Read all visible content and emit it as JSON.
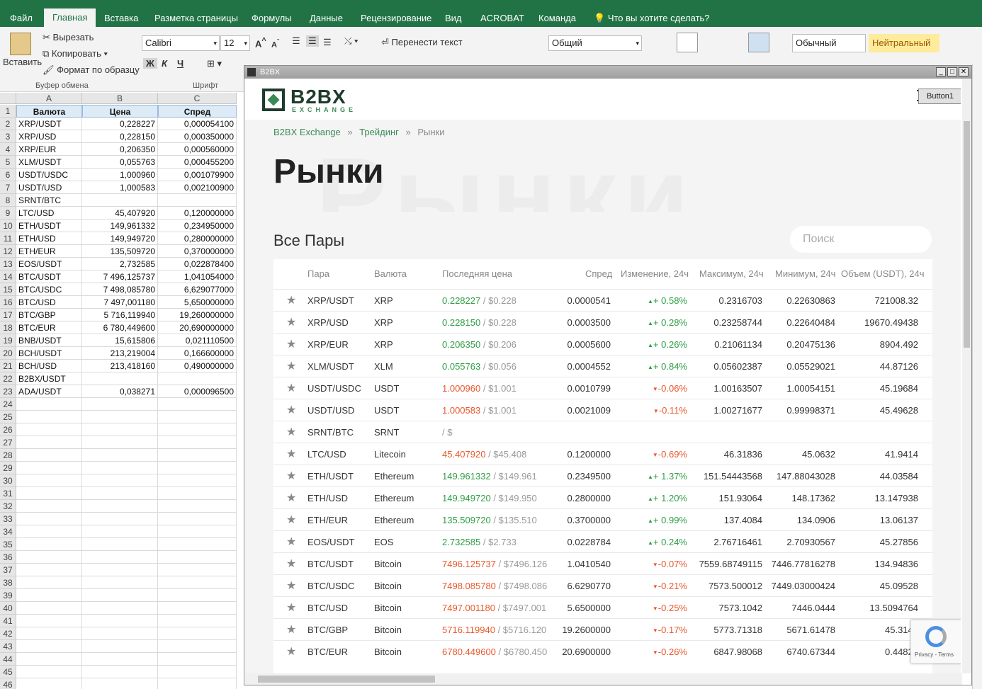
{
  "excel": {
    "tabs": [
      "Файл",
      "Главная",
      "Вставка",
      "Разметка страницы",
      "Формулы",
      "Данные",
      "Рецензирование",
      "Вид",
      "ACROBAT",
      "Команда"
    ],
    "tellme": "Что вы хотите сделать?",
    "clipboard": {
      "paste": "Вставить",
      "cut": "Вырезать",
      "copy": "Копировать",
      "format_painter": "Формат по образцу",
      "group": "Буфер обмена"
    },
    "font": {
      "name": "Calibri",
      "size": "12",
      "group": "Шрифт",
      "bold": "Ж",
      "italic": "К",
      "underline": "Ч"
    },
    "wrap_text": "Перенести текст",
    "number_format": "Общий",
    "style_normal": "Обычный",
    "style_neutral": "Нейтральный",
    "columns": [
      "A",
      "B",
      "C"
    ],
    "header_row": [
      "Валюта",
      "Цена",
      "Спред"
    ],
    "rows": [
      [
        "XRP/USDT",
        "0,228227",
        "0,000054100"
      ],
      [
        "XRP/USD",
        "0,228150",
        "0,000350000"
      ],
      [
        "XRP/EUR",
        "0,206350",
        "0,000560000"
      ],
      [
        "XLM/USDT",
        "0,055763",
        "0,000455200"
      ],
      [
        "USDT/USDC",
        "1,000960",
        "0,001079900"
      ],
      [
        "USDT/USD",
        "1,000583",
        "0,002100900"
      ],
      [
        "SRNT/BTC",
        "",
        ""
      ],
      [
        "LTC/USD",
        "45,407920",
        "0,120000000"
      ],
      [
        "ETH/USDT",
        "149,961332",
        "0,234950000"
      ],
      [
        "ETH/USD",
        "149,949720",
        "0,280000000"
      ],
      [
        "ETH/EUR",
        "135,509720",
        "0,370000000"
      ],
      [
        "EOS/USDT",
        "2,732585",
        "0,022878400"
      ],
      [
        "BTC/USDT",
        "7 496,125737",
        "1,041054000"
      ],
      [
        "BTC/USDC",
        "7 498,085780",
        "6,629077000"
      ],
      [
        "BTC/USD",
        "7 497,001180",
        "5,650000000"
      ],
      [
        "BTC/GBP",
        "5 716,119940",
        "19,260000000"
      ],
      [
        "BTC/EUR",
        "6 780,449600",
        "20,690000000"
      ],
      [
        "BNB/USDT",
        "15,615806",
        "0,021110500"
      ],
      [
        "BCH/USDT",
        "213,219004",
        "0,166600000"
      ],
      [
        "BCH/USD",
        "213,418160",
        "0,490000000"
      ],
      [
        "B2BX/USDT",
        "",
        ""
      ],
      [
        "ADA/USDT",
        "0,038271",
        "0,000096500"
      ]
    ],
    "row_numbers": [
      "1",
      "2",
      "3",
      "4",
      "5",
      "6",
      "7",
      "8",
      "9",
      "10",
      "11",
      "12",
      "13",
      "14",
      "15",
      "16",
      "17",
      "18",
      "19",
      "20",
      "21",
      "22",
      "23",
      "24",
      "25",
      "26",
      "27",
      "28",
      "29",
      "30",
      "31",
      "32",
      "33",
      "34",
      "35",
      "36",
      "37",
      "38",
      "39",
      "40",
      "41",
      "42",
      "43",
      "44",
      "45",
      "46"
    ]
  },
  "window": {
    "title": "B2BX",
    "button1": "Button1",
    "logo_main": "B2BX",
    "logo_sub": "EXCHANGE",
    "breadcrumb": [
      "B2BX Exchange",
      "Трейдинг",
      "Рынки"
    ],
    "breadcrumb_sep": "»",
    "page_title": "Рынки",
    "bg_text": "Рынки",
    "section_title": "Все Пары",
    "search_placeholder": "Поиск",
    "columns": [
      "Пара",
      "Валюта",
      "Последняя цена",
      "Спред",
      "Изменение, 24ч",
      "Максимум, 24ч",
      "Минимум, 24ч",
      "Объем (USDT), 24ч"
    ],
    "rows": [
      {
        "pair": "XRP/USDT",
        "currency": "XRP",
        "price": "0.228227",
        "usd": "/ $0.228",
        "spread": "0.0000541",
        "change": "+ 0.58%",
        "dir": "up",
        "max": "0.2316703",
        "min": "0.22630863",
        "vol": "721008.32"
      },
      {
        "pair": "XRP/USD",
        "currency": "XRP",
        "price": "0.228150",
        "usd": "/ $0.228",
        "spread": "0.0003500",
        "change": "+ 0.28%",
        "dir": "up",
        "max": "0.23258744",
        "min": "0.22640484",
        "vol": "19670.49438"
      },
      {
        "pair": "XRP/EUR",
        "currency": "XRP",
        "price": "0.206350",
        "usd": "/ $0.206",
        "spread": "0.0005600",
        "change": "+ 0.26%",
        "dir": "up",
        "max": "0.21061134",
        "min": "0.20475136",
        "vol": "8904.492"
      },
      {
        "pair": "XLM/USDT",
        "currency": "XLM",
        "price": "0.055763",
        "usd": "/ $0.056",
        "spread": "0.0004552",
        "change": "+ 0.84%",
        "dir": "up",
        "max": "0.05602387",
        "min": "0.05529021",
        "vol": "44.87126"
      },
      {
        "pair": "USDT/USDC",
        "currency": "USDT",
        "price": "1.000960",
        "usd": "/ $1.001",
        "spread": "0.0010799",
        "change": "-0.06%",
        "dir": "dn",
        "max": "1.00163507",
        "min": "1.00054151",
        "vol": "45.19684"
      },
      {
        "pair": "USDT/USD",
        "currency": "USDT",
        "price": "1.000583",
        "usd": "/ $1.001",
        "spread": "0.0021009",
        "change": "-0.11%",
        "dir": "dn",
        "max": "1.00271677",
        "min": "0.99998371",
        "vol": "45.49628"
      },
      {
        "pair": "SRNT/BTC",
        "currency": "SRNT",
        "price": "",
        "usd": "/ $",
        "spread": "",
        "change": "",
        "dir": "none",
        "max": "",
        "min": "",
        "vol": ""
      },
      {
        "pair": "LTC/USD",
        "currency": "Litecoin",
        "price": "45.407920",
        "usd": "/ $45.408",
        "spread": "0.1200000",
        "change": "-0.69%",
        "dir": "dn",
        "max": "46.31836",
        "min": "45.0632",
        "vol": "41.9414"
      },
      {
        "pair": "ETH/USDT",
        "currency": "Ethereum",
        "price": "149.961332",
        "usd": "/ $149.961",
        "spread": "0.2349500",
        "change": "+ 1.37%",
        "dir": "up",
        "max": "151.54443568",
        "min": "147.88043028",
        "vol": "44.03584"
      },
      {
        "pair": "ETH/USD",
        "currency": "Ethereum",
        "price": "149.949720",
        "usd": "/ $149.950",
        "spread": "0.2800000",
        "change": "+ 1.20%",
        "dir": "up",
        "max": "151.93064",
        "min": "148.17362",
        "vol": "13.147938"
      },
      {
        "pair": "ETH/EUR",
        "currency": "Ethereum",
        "price": "135.509720",
        "usd": "/ $135.510",
        "spread": "0.3700000",
        "change": "+ 0.99%",
        "dir": "up",
        "max": "137.4084",
        "min": "134.0906",
        "vol": "13.06137"
      },
      {
        "pair": "EOS/USDT",
        "currency": "EOS",
        "price": "2.732585",
        "usd": "/ $2.733",
        "spread": "0.0228784",
        "change": "+ 0.24%",
        "dir": "up",
        "max": "2.76716461",
        "min": "2.70930567",
        "vol": "45.27856"
      },
      {
        "pair": "BTC/USDT",
        "currency": "Bitcoin",
        "price": "7496.125737",
        "usd": "/ $7496.126",
        "spread": "1.0410540",
        "change": "-0.07%",
        "dir": "dn",
        "max": "7559.68749115",
        "min": "7446.77816278",
        "vol": "134.94836"
      },
      {
        "pair": "BTC/USDC",
        "currency": "Bitcoin",
        "price": "7498.085780",
        "usd": "/ $7498.086",
        "spread": "6.6290770",
        "change": "-0.21%",
        "dir": "dn",
        "max": "7573.500012",
        "min": "7449.03000424",
        "vol": "45.09528"
      },
      {
        "pair": "BTC/USD",
        "currency": "Bitcoin",
        "price": "7497.001180",
        "usd": "/ $7497.001",
        "spread": "5.6500000",
        "change": "-0.25%",
        "dir": "dn",
        "max": "7573.1042",
        "min": "7446.0444",
        "vol": "13.5094764"
      },
      {
        "pair": "BTC/GBP",
        "currency": "Bitcoin",
        "price": "5716.119940",
        "usd": "/ $5716.120",
        "spread": "19.2600000",
        "change": "-0.17%",
        "dir": "dn",
        "max": "5773.71318",
        "min": "5671.61478",
        "vol": "45.3143"
      },
      {
        "pair": "BTC/EUR",
        "currency": "Bitcoin",
        "price": "6780.449600",
        "usd": "/ $6780.450",
        "spread": "20.6900000",
        "change": "-0.26%",
        "dir": "dn",
        "max": "6847.98068",
        "min": "6740.67344",
        "vol": "0.44828"
      }
    ],
    "recaptcha_text": "Privacy - Terms"
  },
  "colors": {
    "excel_green": "#217346",
    "price_up": "#2e9e45",
    "price_down": "#e8582b",
    "link": "#3a8a57"
  }
}
